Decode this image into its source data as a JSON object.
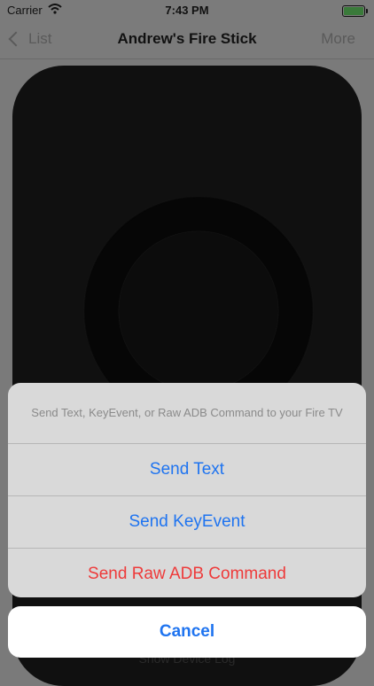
{
  "status_bar": {
    "carrier": "Carrier",
    "time": "7:43 PM",
    "icons": [
      "wifi-icon",
      "battery-icon"
    ]
  },
  "nav": {
    "back_label": "List",
    "title": "Andrew's Fire Stick",
    "more_label": "More"
  },
  "remote": {
    "footer_label": "Show Device Log"
  },
  "action_sheet": {
    "message": "Send Text, KeyEvent, or Raw ADB Command to your Fire TV",
    "actions": [
      {
        "label": "Send Text"
      },
      {
        "label": "Send KeyEvent"
      },
      {
        "label": "Send Raw ADB Command"
      }
    ],
    "cancel_label": "Cancel"
  },
  "colors": {
    "accent": "#1f74f0",
    "destructive": "#ee3a3a",
    "sheet_bg": "#d9d9d9",
    "remote_bg": "#101010"
  }
}
